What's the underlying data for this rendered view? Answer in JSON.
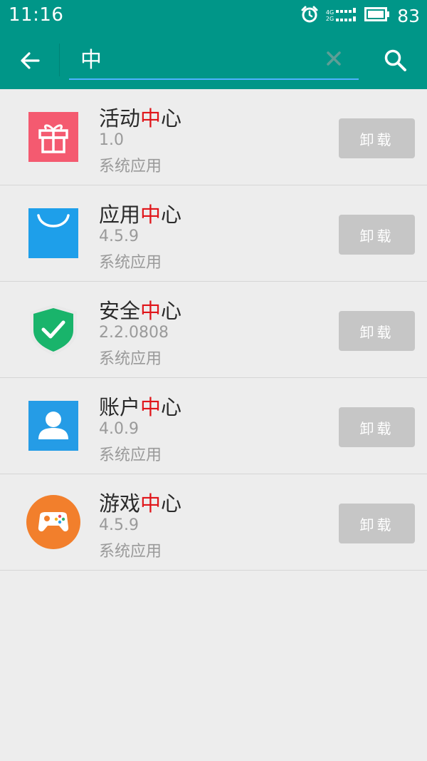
{
  "status_bar": {
    "time": "11:16",
    "battery": "83",
    "network_top": "4G",
    "network_bottom": "2G"
  },
  "search": {
    "value": "中",
    "back_icon": "arrow-left-icon",
    "clear_icon": "close-icon",
    "search_icon": "search-icon"
  },
  "colors": {
    "accent": "#009688",
    "highlight": "#e0151a",
    "button": "#c6c6c6"
  },
  "apps": [
    {
      "name_prefix": "活动",
      "name_match": "中",
      "name_suffix": "心",
      "version": "1.0",
      "category": "系统应用",
      "action": "卸载",
      "icon": "gift-icon",
      "icon_color": "#f45a70"
    },
    {
      "name_prefix": "应用",
      "name_match": "中",
      "name_suffix": "心",
      "version": "4.5.9",
      "category": "系统应用",
      "action": "卸载",
      "icon": "shopping-bag-icon",
      "icon_color": "#1e9fea"
    },
    {
      "name_prefix": "安全",
      "name_match": "中",
      "name_suffix": "心",
      "version": "2.2.0808",
      "category": "系统应用",
      "action": "卸载",
      "icon": "shield-check-icon",
      "icon_color": "#19b46b"
    },
    {
      "name_prefix": "账户",
      "name_match": "中",
      "name_suffix": "心",
      "version": "4.0.9",
      "category": "系统应用",
      "action": "卸载",
      "icon": "user-icon",
      "icon_color": "#259ce6"
    },
    {
      "name_prefix": "游戏",
      "name_match": "中",
      "name_suffix": "心",
      "version": "4.5.9",
      "category": "系统应用",
      "action": "卸载",
      "icon": "gamepad-icon",
      "icon_color": "#f27f2c"
    }
  ]
}
